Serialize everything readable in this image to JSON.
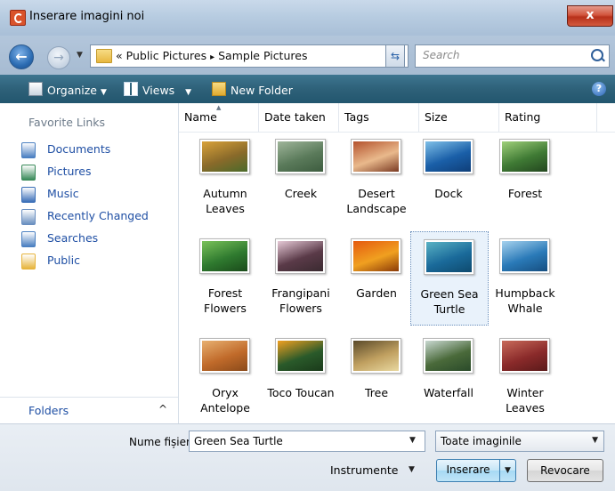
{
  "window": {
    "title": "Inserare imagini noi",
    "close_glyph": "x"
  },
  "address": {
    "prefix": "«",
    "segments": [
      "Public Pictures",
      "Sample Pictures"
    ],
    "separator": "▸",
    "search_placeholder": "Search"
  },
  "toolbar": {
    "organize": "Organize",
    "views": "Views",
    "new_folder": "New Folder",
    "help": "?"
  },
  "sidebar": {
    "header": "Favorite Links",
    "items": [
      {
        "label": "Documents",
        "icon": "documents-icon",
        "color": "#4a7fc1"
      },
      {
        "label": "Pictures",
        "icon": "pictures-icon",
        "color": "#3a8a5a"
      },
      {
        "label": "Music",
        "icon": "music-icon",
        "color": "#3b6fb8"
      },
      {
        "label": "Recently Changed",
        "icon": "recently-changed-icon",
        "color": "#6a8fc0"
      },
      {
        "label": "Searches",
        "icon": "searches-icon",
        "color": "#4a7fc1"
      },
      {
        "label": "Public",
        "icon": "folder-icon",
        "color": "#e6b43c"
      }
    ],
    "folders_label": "Folders",
    "folders_caret": "^"
  },
  "columns": [
    "Name",
    "Date taken",
    "Tags",
    "Size",
    "Rating"
  ],
  "files": [
    {
      "name": "Autumn Leaves",
      "l1": "Autumn",
      "l2": "Leaves",
      "thumb": [
        "#8a6a2a",
        "#d9a23a",
        "#4a6a2a"
      ]
    },
    {
      "name": "Creek",
      "l1": "Creek",
      "l2": "",
      "thumb": [
        "#5a7a5a",
        "#9fb59a",
        "#3d5c3f"
      ]
    },
    {
      "name": "Desert Landscape",
      "l1": "Desert",
      "l2": "Landscape",
      "thumb": [
        "#e9b98c",
        "#b4522d",
        "#7a3a22"
      ]
    },
    {
      "name": "Dock",
      "l1": "Dock",
      "l2": "",
      "thumb": [
        "#1a5fa8",
        "#7fc0e8",
        "#0f3e78"
      ]
    },
    {
      "name": "Forest",
      "l1": "Forest",
      "l2": "",
      "thumb": [
        "#3f7a34",
        "#9fd07a",
        "#23461f"
      ]
    },
    {
      "name": "Forest Flowers",
      "l1": "Forest",
      "l2": "Flowers",
      "thumb": [
        "#2f7a2f",
        "#7ac25a",
        "#1a4a1a"
      ]
    },
    {
      "name": "Frangipani Flowers",
      "l1": "Frangipani",
      "l2": "Flowers",
      "thumb": [
        "#5a3a48",
        "#e6c9d6",
        "#3a2a30"
      ]
    },
    {
      "name": "Garden",
      "l1": "Garden",
      "l2": "",
      "thumb": [
        "#f0a020",
        "#e55a10",
        "#8a3a08"
      ]
    },
    {
      "name": "Green Sea Turtle",
      "l1": "Green Sea",
      "l2": "Turtle",
      "thumb": [
        "#1a6a9a",
        "#59b2c4",
        "#0e4a6e"
      ]
    },
    {
      "name": "Humpback Whale",
      "l1": "Humpback",
      "l2": "Whale",
      "thumb": [
        "#2a7ab8",
        "#a6d2ee",
        "#164e80"
      ]
    },
    {
      "name": "Oryx Antelope",
      "l1": "Oryx",
      "l2": "Antelope",
      "thumb": [
        "#c06a2a",
        "#e8b070",
        "#8a4a1a"
      ]
    },
    {
      "name": "Toco Toucan",
      "l1": "Toco Toucan",
      "l2": "",
      "thumb": [
        "#2a5a2a",
        "#f0a020",
        "#1a3a1a"
      ]
    },
    {
      "name": "Tree",
      "l1": "Tree",
      "l2": "",
      "thumb": [
        "#c0a060",
        "#5a4a2a",
        "#e8d8a0"
      ]
    },
    {
      "name": "Waterfall",
      "l1": "Waterfall",
      "l2": "",
      "thumb": [
        "#4a6a3a",
        "#c8d8d0",
        "#2a4a2a"
      ]
    },
    {
      "name": "Winter Leaves",
      "l1": "Winter",
      "l2": "Leaves",
      "thumb": [
        "#8a2a2a",
        "#c86a5a",
        "#5a1a1a"
      ]
    }
  ],
  "selected_index": 8,
  "footer": {
    "filename_label": "Nume fișier:",
    "filename_value": "Green Sea Turtle",
    "filetype": "Toate imaginile",
    "tools": "Instrumente",
    "insert": "Inserare",
    "cancel": "Revocare"
  }
}
